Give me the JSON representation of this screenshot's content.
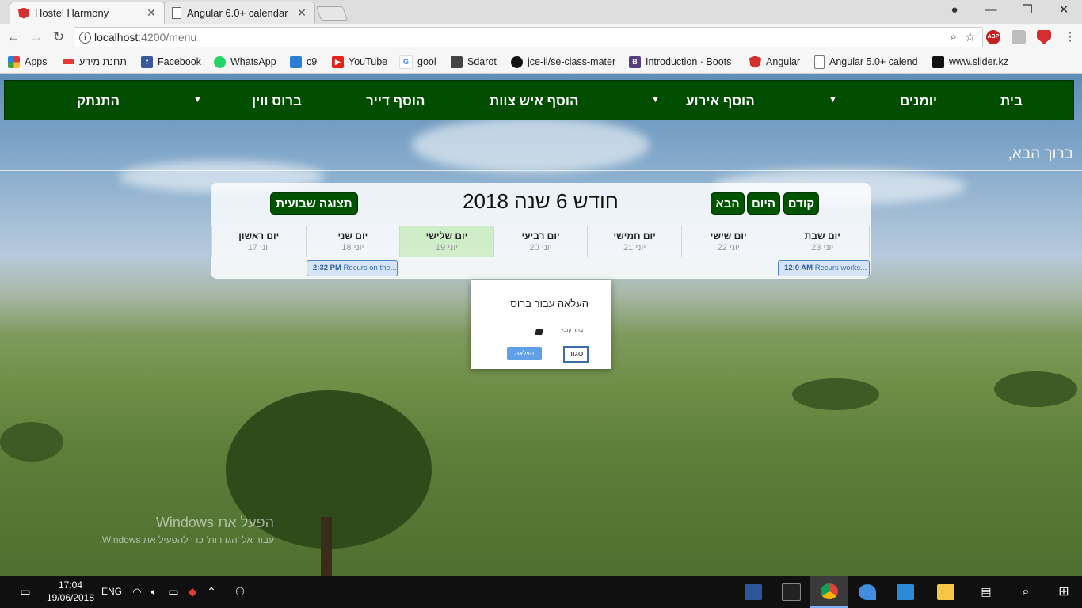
{
  "browser": {
    "tabs": [
      {
        "title": "Hostel Harmony",
        "active": true,
        "icon": "angular-icon"
      },
      {
        "title": "Angular 6.0+ calendar",
        "active": false,
        "icon": "page-icon"
      }
    ],
    "address": {
      "host": "localhost",
      "path": ":4200/menu"
    },
    "bookmarks": [
      {
        "label": "Apps",
        "icon": "apps-grid-icon"
      },
      {
        "label": "תחנת מידע",
        "icon": "bookmark-red-icon"
      },
      {
        "label": "Facebook",
        "icon": "facebook-icon"
      },
      {
        "label": "WhatsApp",
        "icon": "whatsapp-icon"
      },
      {
        "label": "c9",
        "icon": "c9-icon"
      },
      {
        "label": "YouTube",
        "icon": "youtube-icon"
      },
      {
        "label": "gool",
        "icon": "google-icon"
      },
      {
        "label": "Sdarot",
        "icon": "tv-icon"
      },
      {
        "label": "jce-il/se-class-mater",
        "icon": "github-icon"
      },
      {
        "label": "Introduction · Boots",
        "icon": "bootstrap-icon"
      },
      {
        "label": "Angular",
        "icon": "angular-icon"
      },
      {
        "label": "Angular 5.0+ calend",
        "icon": "page-icon"
      },
      {
        "label": "www.slider.kz",
        "icon": "slider-icon"
      }
    ],
    "extensions": [
      "ABP"
    ]
  },
  "navbar": {
    "items": [
      "בית",
      "יומנים",
      "הוסף אירוע",
      "הוסף איש צוות",
      "הוסף דייר",
      "ברוס ווין",
      "התנתק"
    ]
  },
  "welcome": "ברוך הבא,",
  "calendar": {
    "title": "חודש 6 שנה 2018",
    "buttons": {
      "prev": "קודם",
      "today": "היום",
      "next": "הבא",
      "weekly": "תצוגה שבועית"
    },
    "days": [
      {
        "name": "יום ראשון",
        "date": "יוני 17",
        "today": false
      },
      {
        "name": "יום שני",
        "date": "יוני 18",
        "today": false
      },
      {
        "name": "יום שלישי",
        "date": "יוני 19",
        "today": true
      },
      {
        "name": "יום רביעי",
        "date": "יוני 20",
        "today": false
      },
      {
        "name": "יום חמישי",
        "date": "יוני 21",
        "today": false
      },
      {
        "name": "יום שישי",
        "date": "יוני 22",
        "today": false
      },
      {
        "name": "יום שבת",
        "date": "יוני 23",
        "today": false
      }
    ],
    "events": [
      {
        "time": "2:32 PM",
        "text": "Recurs on the..."
      },
      {
        "time": "12:0 AM",
        "text": "Recurs works..."
      }
    ]
  },
  "modal": {
    "title": "העלאה עבור ברוס",
    "file_label": "בחר קובץ",
    "upload_label": "העלאה",
    "close_label": "סגור"
  },
  "watermark": {
    "line1": "הפעל את Windows",
    "line2": "עבור אל 'הגדרות' כדי להפעיל את Windows."
  },
  "taskbar": {
    "lang": "ENG",
    "time": "17:04",
    "date": "19/06/2018"
  },
  "colors": {
    "navbar": "#004d00",
    "button": "#005400",
    "today": "#c8ebbe",
    "event": "#4a85c9"
  }
}
